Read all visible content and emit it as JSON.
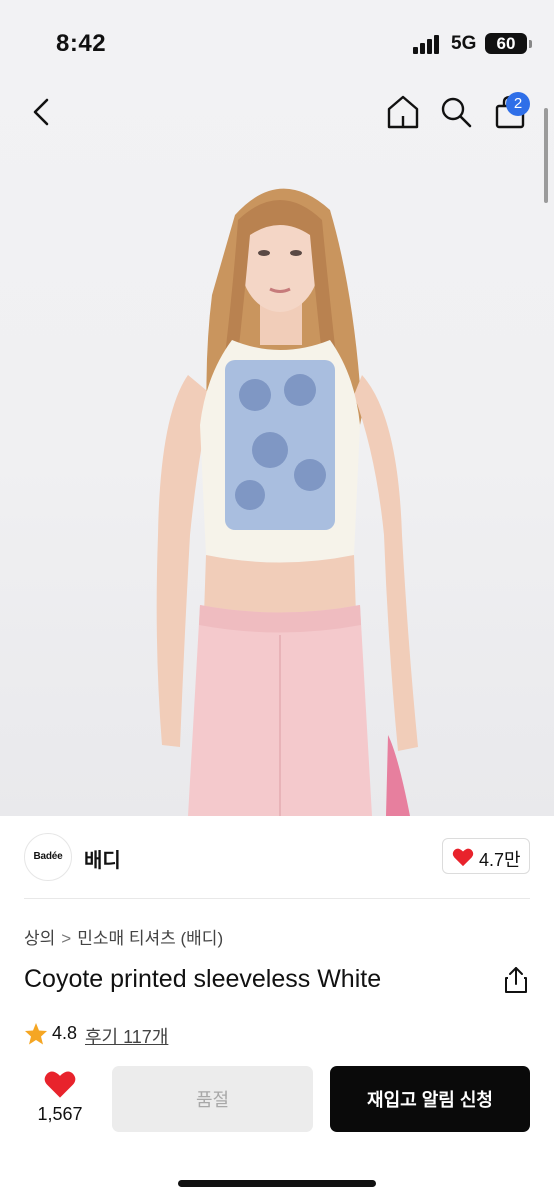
{
  "status_bar": {
    "time": "8:42",
    "network": "5G",
    "battery": "60"
  },
  "nav": {
    "cart_count": "2",
    "icons": [
      "back-icon",
      "home-icon",
      "search-icon",
      "shopping-bag-icon"
    ]
  },
  "hero": {
    "image": "model wearing white printed sleeveless crop top and pink wide pants"
  },
  "brand": {
    "logo_text": "Badée",
    "name": "배디",
    "likes": "4.7만"
  },
  "breadcrumb": {
    "category": "상의",
    "separator": ">",
    "subcategory": "민소매 티셔츠 (배디)"
  },
  "product": {
    "title": "Coyote printed sleeveless White"
  },
  "rating": {
    "value": "4.8",
    "reviews": "후기 117개"
  },
  "actions": {
    "wish_count": "1,567",
    "soldout_label": "품절",
    "restock_label": "재입고 알림 신청"
  },
  "colors": {
    "accent_red": "#e8232c",
    "badge_blue": "#2f6fe8",
    "star": "#f5a623",
    "primary": "#0a0a0a"
  }
}
